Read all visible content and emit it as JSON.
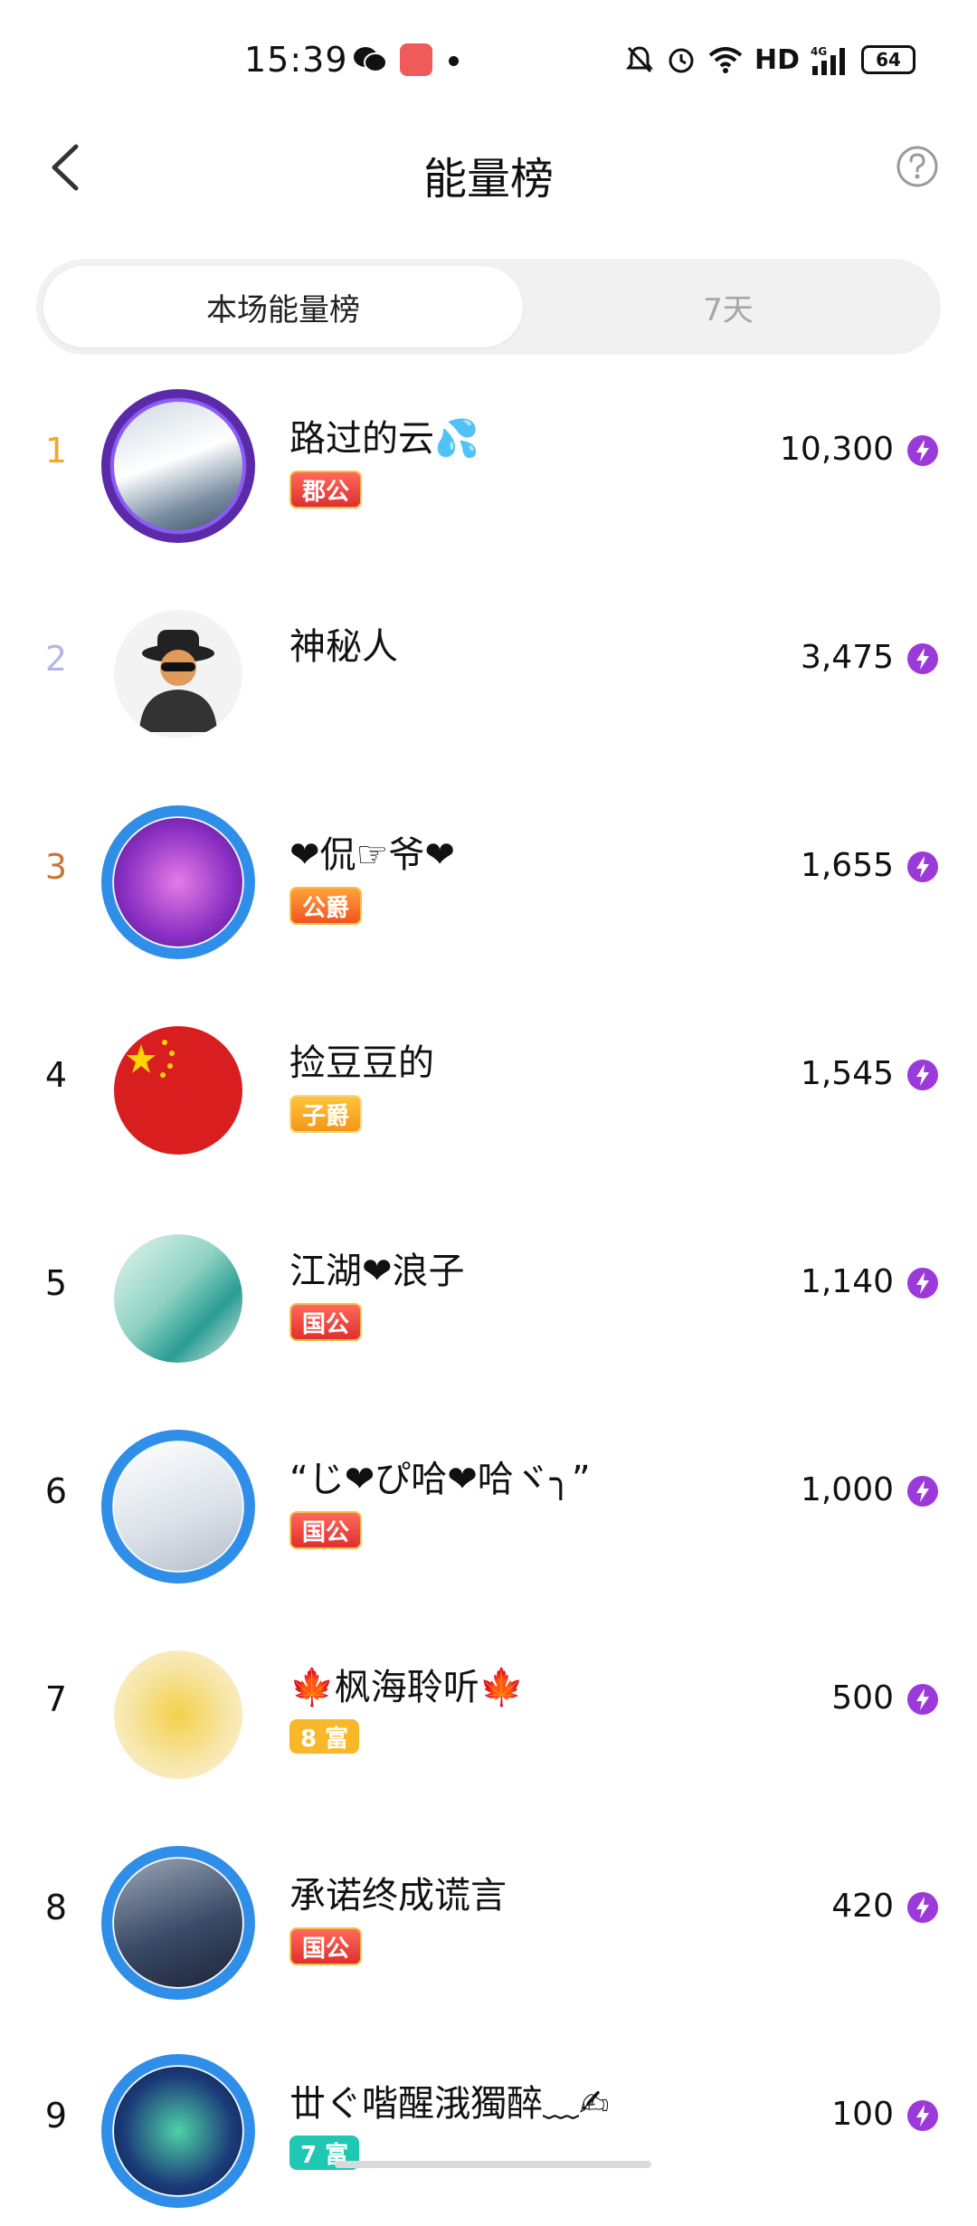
{
  "status": {
    "time": "15:39",
    "network": "HD",
    "signal": "4G",
    "battery": "64"
  },
  "header": {
    "title": "能量榜",
    "back_icon": "chevron-left-icon",
    "help_icon": "question-circle-icon"
  },
  "tabs": [
    {
      "label": "本场能量榜",
      "active": true
    },
    {
      "label": "7天",
      "active": false
    }
  ],
  "colors": {
    "rank1": "#f5a623",
    "rank2": "#b4b4e6",
    "rank3": "#c87832",
    "energy": "#9b3ad9"
  },
  "list": [
    {
      "rank": "1",
      "name": "路过的云💦",
      "badge": "郡公",
      "score": "10,300"
    },
    {
      "rank": "2",
      "name": "神秘人",
      "badge": "",
      "score": "3,475"
    },
    {
      "rank": "3",
      "name": "❤侃☞爷❤",
      "badge": "公爵",
      "score": "1,655"
    },
    {
      "rank": "4",
      "name": "捡豆豆的",
      "badge": "子爵",
      "score": "1,545"
    },
    {
      "rank": "5",
      "name": "江湖❤浪子",
      "badge": "国公",
      "score": "1,140"
    },
    {
      "rank": "6",
      "name": "“じ❤ぴ哈❤哈ヾ╮”",
      "badge": "国公",
      "score": "1,000"
    },
    {
      "rank": "7",
      "name": "🍁枫海聆听🍁",
      "badge": "8 富",
      "score": "500"
    },
    {
      "rank": "8",
      "name": "承诺终成谎言",
      "badge": "国公",
      "score": "420"
    },
    {
      "rank": "9",
      "name": "丗ぐ喈醒涐獨醉﹏✍",
      "badge": "7 富",
      "score": "100"
    }
  ]
}
